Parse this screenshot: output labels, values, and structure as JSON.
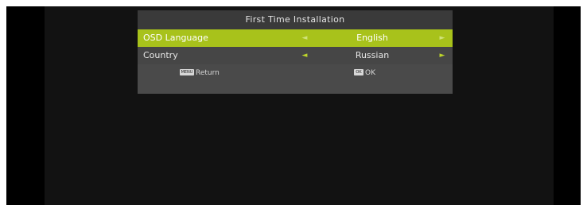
{
  "osd": {
    "title": "First Time Installation",
    "rows": [
      {
        "label": "OSD Language",
        "value": "English",
        "left_arrow": "◄",
        "right_arrow": "►"
      },
      {
        "label": "Country",
        "value": "Russian",
        "left_arrow": "◄",
        "right_arrow": "►"
      }
    ],
    "footer": {
      "return_key": "MENU",
      "return_label": "Return",
      "ok_key": "OK",
      "ok_label": "OK"
    }
  },
  "colors": {
    "highlight": "#a8c21b",
    "panel": "#4a4a4a",
    "screen": "#121212",
    "bezel": "#000000"
  }
}
